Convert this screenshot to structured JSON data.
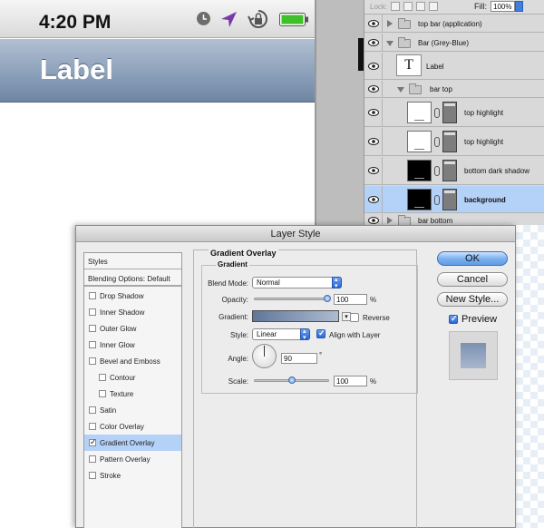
{
  "ios": {
    "time": "4:20 PM",
    "nav_title": "Label",
    "status_icons": [
      "clock-icon",
      "location-arrow-icon",
      "rotation-lock-icon",
      "battery-icon"
    ],
    "nav_gradient": [
      "#b2c0d2",
      "#6f86a3"
    ]
  },
  "layers_panel": {
    "lock_label": "Lock:",
    "fill_label": "Fill:",
    "fill_value": "100%",
    "layers": [
      {
        "name": "top bar (application)",
        "kind": "group",
        "expanded": false
      },
      {
        "name": "Bar (Grey-Blue)",
        "kind": "group",
        "expanded": true
      },
      {
        "name": "Label",
        "kind": "text"
      },
      {
        "name": "bar top",
        "kind": "group",
        "expanded": true
      },
      {
        "name": "top highlight",
        "kind": "shape"
      },
      {
        "name": "top highlight",
        "kind": "shape"
      },
      {
        "name": "bottom dark shadow",
        "kind": "shape"
      },
      {
        "name": "background",
        "kind": "shape",
        "selected": true
      },
      {
        "name": "bar bottom",
        "kind": "group",
        "expanded": false
      }
    ]
  },
  "dialog": {
    "title": "Layer Style",
    "styles_header": "Styles",
    "blending_options": "Blending Options: Default",
    "effects": [
      {
        "label": "Drop Shadow",
        "checked": false,
        "indent": false
      },
      {
        "label": "Inner Shadow",
        "checked": false,
        "indent": false
      },
      {
        "label": "Outer Glow",
        "checked": false,
        "indent": false
      },
      {
        "label": "Inner Glow",
        "checked": false,
        "indent": false
      },
      {
        "label": "Bevel and Emboss",
        "checked": false,
        "indent": false
      },
      {
        "label": "Contour",
        "checked": false,
        "indent": true
      },
      {
        "label": "Texture",
        "checked": false,
        "indent": true
      },
      {
        "label": "Satin",
        "checked": false,
        "indent": false
      },
      {
        "label": "Color Overlay",
        "checked": false,
        "indent": false
      },
      {
        "label": "Gradient Overlay",
        "checked": true,
        "indent": false,
        "selected": true
      },
      {
        "label": "Pattern Overlay",
        "checked": false,
        "indent": false
      },
      {
        "label": "Stroke",
        "checked": false,
        "indent": false
      }
    ],
    "section_title": "Gradient Overlay",
    "group_title": "Gradient",
    "blend_mode_label": "Blend Mode:",
    "blend_mode_value": "Normal",
    "opacity_label": "Opacity:",
    "opacity_value": "100",
    "opacity_fraction": 1.0,
    "percent": "%",
    "gradient_label": "Gradient:",
    "gradient_colors": [
      "#61779a",
      "#aebbd0"
    ],
    "reverse_label": "Reverse",
    "reverse_checked": false,
    "style_label": "Style:",
    "style_value": "Linear",
    "align_label": "Align with Layer",
    "align_checked": true,
    "angle_label": "Angle:",
    "angle_value": "90",
    "degree": "°",
    "scale_label": "Scale:",
    "scale_value": "100",
    "scale_fraction": 0.5,
    "buttons": {
      "ok": "OK",
      "cancel": "Cancel",
      "new_style": "New Style..."
    },
    "preview_label": "Preview",
    "preview_checked": true
  }
}
